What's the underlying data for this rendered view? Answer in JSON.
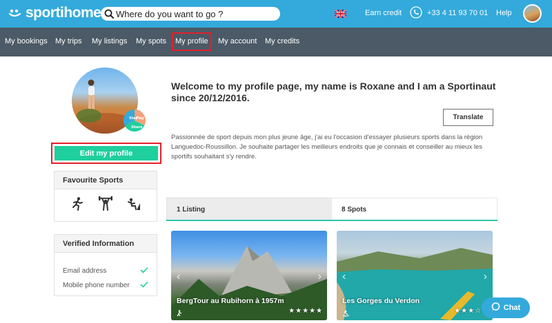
{
  "header": {
    "logo_text": "sportihome",
    "search_placeholder": "Where do you want to go ?",
    "language_flag": "uk-flag-icon",
    "earn_credit": "Earn credit",
    "phone": "+33 4 11 93 70 01",
    "help": "Help"
  },
  "nav": {
    "items": [
      "My bookings",
      "My trips",
      "My listings",
      "My spots",
      "My profile",
      "My account",
      "My credits"
    ],
    "active": "My profile"
  },
  "profile": {
    "badge_labels": [
      "Stay",
      "Play",
      "Share"
    ],
    "edit_button": "Edit my profile",
    "headline": "Welcome to my profile page, my name is Roxane and I am a Sportinaut since 20/12/2016.",
    "translate_button": "Translate",
    "bio": "Passionnée de sport depuis mon plus jeune âge, j'ai eu l'occasion d'essayer plusieurs sports dans la région Languedoc-Roussillon. Je souhaite partager les meilleurs endroits que je connais et conseiller au mieux les sportifs souhaitant s'y rendre."
  },
  "favourite_sports": {
    "title": "Favourite Sports",
    "icons": [
      "running-icon",
      "weightlifting-icon",
      "climbing-icon"
    ]
  },
  "verified": {
    "title": "Verified Information",
    "items": [
      {
        "label": "Email address",
        "verified": true
      },
      {
        "label": "Mobile phone number",
        "verified": true
      }
    ]
  },
  "tabs": {
    "listing": "1 Listing",
    "spots": "8 Spots",
    "active": "8 Spots"
  },
  "cards": [
    {
      "title": "BergTour au Rubihorn à 1957m",
      "rating": 4.5,
      "stars": "★★★★★"
    },
    {
      "title": "Les Gorges du Verdon",
      "rating": 3,
      "stars": "★★★☆☆"
    }
  ],
  "chat_button": "Chat",
  "colors": {
    "header": "#34aadc",
    "subnav": "#4b5a66",
    "accent": "#1fcf9d",
    "highlight": "#e3202b"
  }
}
